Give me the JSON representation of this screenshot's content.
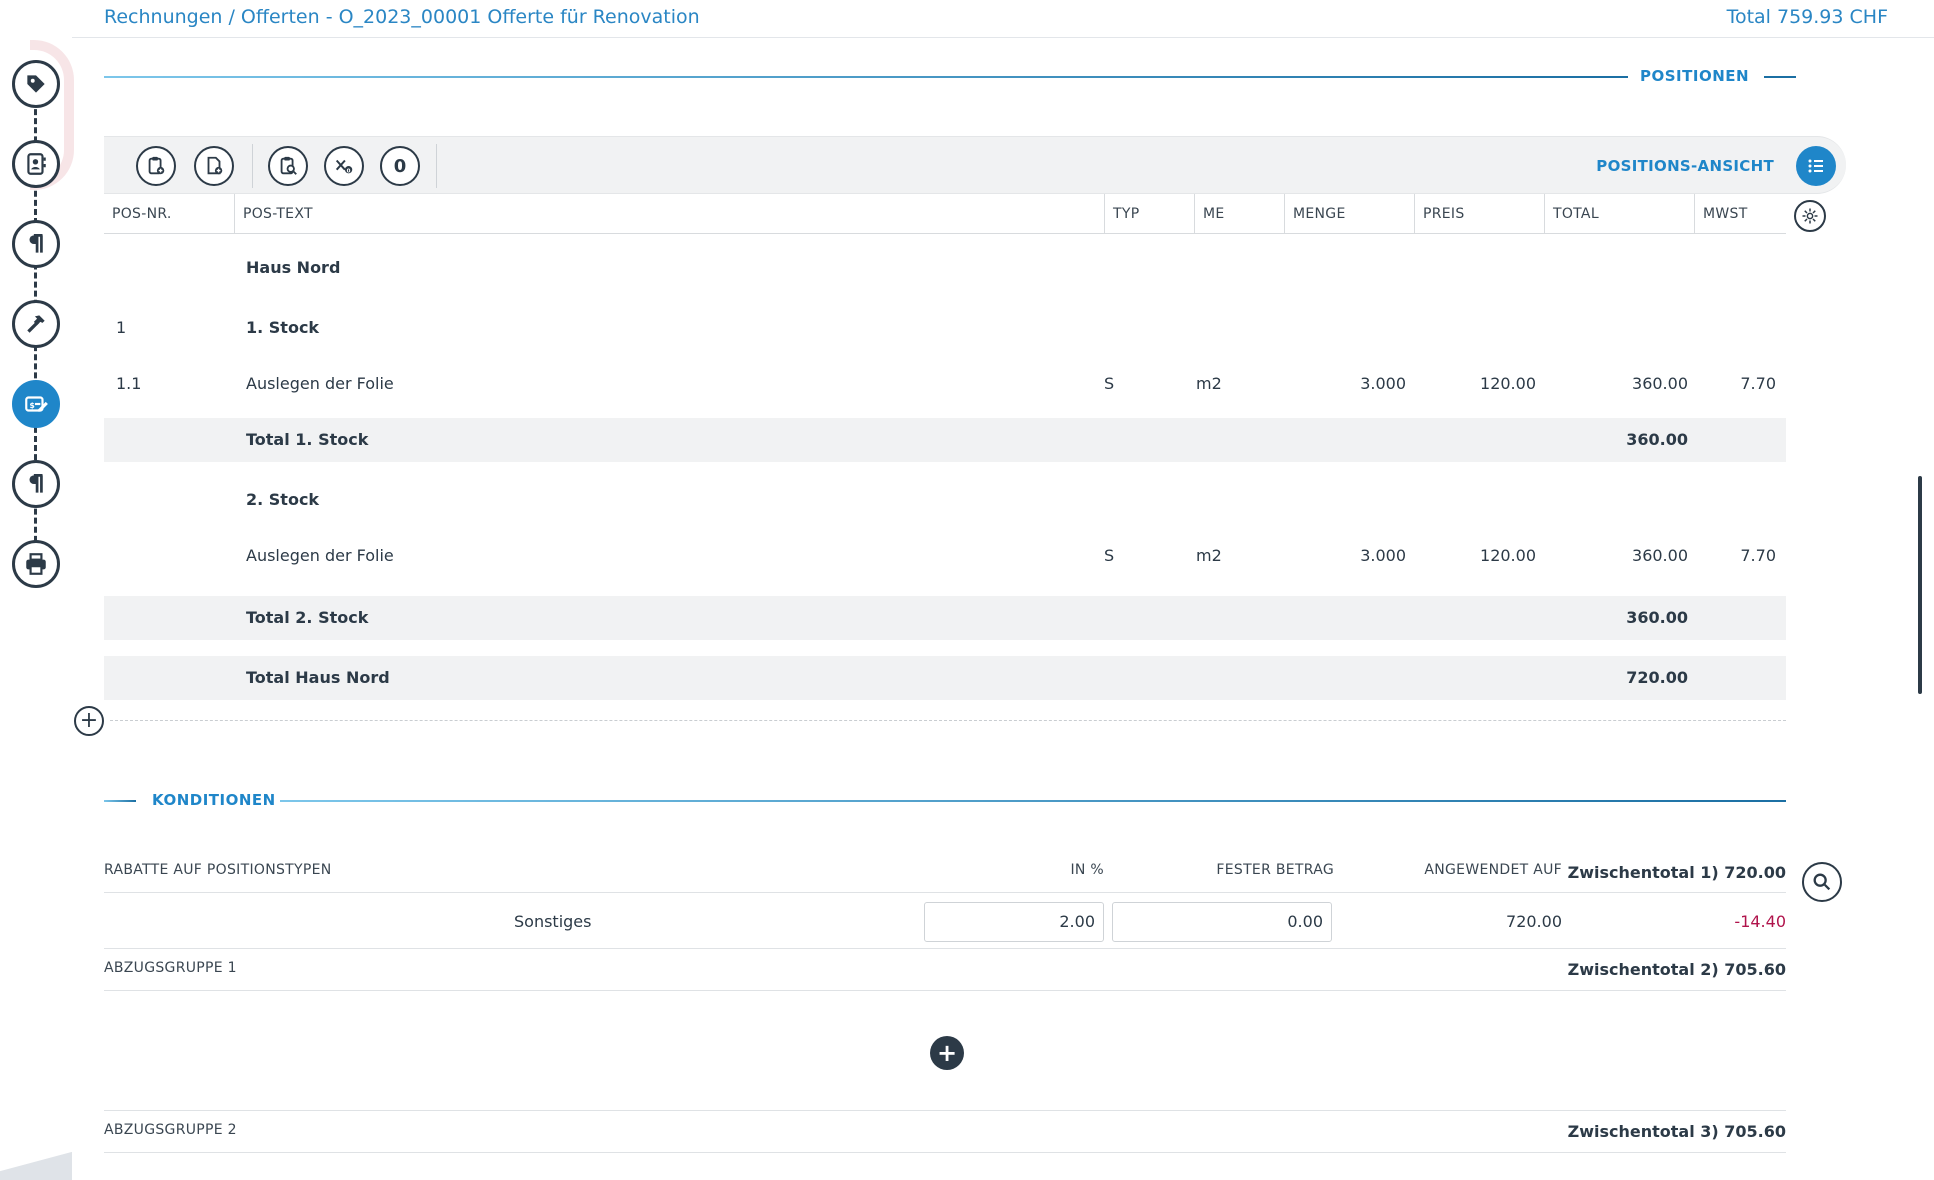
{
  "header": {
    "breadcrumb": "Rechnungen / Offerten - O_2023_00001 Offerte für Renovation",
    "total": "Total 759.93 CHF"
  },
  "sidebar": {
    "steps": [
      {
        "icon": "tag-icon",
        "active": false
      },
      {
        "icon": "contact-card-icon",
        "active": false
      },
      {
        "icon": "paragraph-icon",
        "active": false
      },
      {
        "icon": "hammer-icon",
        "active": false
      },
      {
        "icon": "price-edit-icon",
        "active": true
      },
      {
        "icon": "paragraph-icon",
        "active": false
      },
      {
        "icon": "printer-icon",
        "active": false
      }
    ]
  },
  "positions": {
    "section_title": "POSITIONEN",
    "view_label": "POSITIONS-ANSICHT",
    "toolbar": {
      "buttons": [
        "clipboard-add-icon",
        "document-add-icon",
        "clipboard-search-icon",
        "clear-x-icon",
        "zero-icon"
      ],
      "zero_label": "0"
    },
    "columns": {
      "pos_nr": "POS-NR.",
      "pos_text": "POS-TEXT",
      "typ": "TYP",
      "me": "ME",
      "menge": "MENGE",
      "preis": "PREIS",
      "total": "TOTAL",
      "mwst": "MWST"
    },
    "rows": [
      {
        "kind": "title",
        "nr": "",
        "text": "Haus Nord",
        "typ": "",
        "me": "",
        "menge": "",
        "preis": "",
        "total": "",
        "mwst": ""
      },
      {
        "kind": "title",
        "nr": "1",
        "text": "1. Stock",
        "typ": "",
        "me": "",
        "menge": "",
        "preis": "",
        "total": "",
        "mwst": ""
      },
      {
        "kind": "item",
        "nr": "1.1",
        "text": "Auslegen der Folie",
        "typ": "S",
        "me": "m2",
        "menge": "3.000",
        "preis": "120.00",
        "total": "360.00",
        "mwst": "7.70"
      },
      {
        "kind": "subtotal",
        "nr": "",
        "text": "Total 1. Stock",
        "typ": "",
        "me": "",
        "menge": "",
        "preis": "",
        "total": "360.00",
        "mwst": ""
      },
      {
        "kind": "title",
        "nr": "",
        "text": "2. Stock",
        "typ": "",
        "me": "",
        "menge": "",
        "preis": "",
        "total": "",
        "mwst": ""
      },
      {
        "kind": "item",
        "nr": "",
        "text": "Auslegen der Folie",
        "typ": "S",
        "me": "m2",
        "menge": "3.000",
        "preis": "120.00",
        "total": "360.00",
        "mwst": "7.70"
      },
      {
        "kind": "subtotal",
        "nr": "",
        "text": "Total 2. Stock",
        "typ": "",
        "me": "",
        "menge": "",
        "preis": "",
        "total": "360.00",
        "mwst": ""
      },
      {
        "kind": "subtotal",
        "nr": "",
        "text": "Total Haus Nord",
        "typ": "",
        "me": "",
        "menge": "",
        "preis": "",
        "total": "720.00",
        "mwst": ""
      }
    ]
  },
  "conditions": {
    "section_title": "KONDITIONEN",
    "discount_header": {
      "label": "RABATTE AUF POSITIONSTYPEN",
      "in_percent": "IN %",
      "fixed": "FESTER BETRAG",
      "applied_on": "ANGEWENDET AUF",
      "subtotal": "Zwischentotal 1) 720.00"
    },
    "discount_row": {
      "label": "Sonstiges",
      "percent": "2.00",
      "fixed": "0.00",
      "applied": "720.00",
      "amount": "-14.40"
    },
    "groups": [
      {
        "label": "ABZUGSGRUPPE 1",
        "subtotal": "Zwischentotal 2) 705.60"
      },
      {
        "label": "ABZUGSGRUPPE 2",
        "subtotal": "Zwischentotal 3) 705.60"
      }
    ]
  }
}
